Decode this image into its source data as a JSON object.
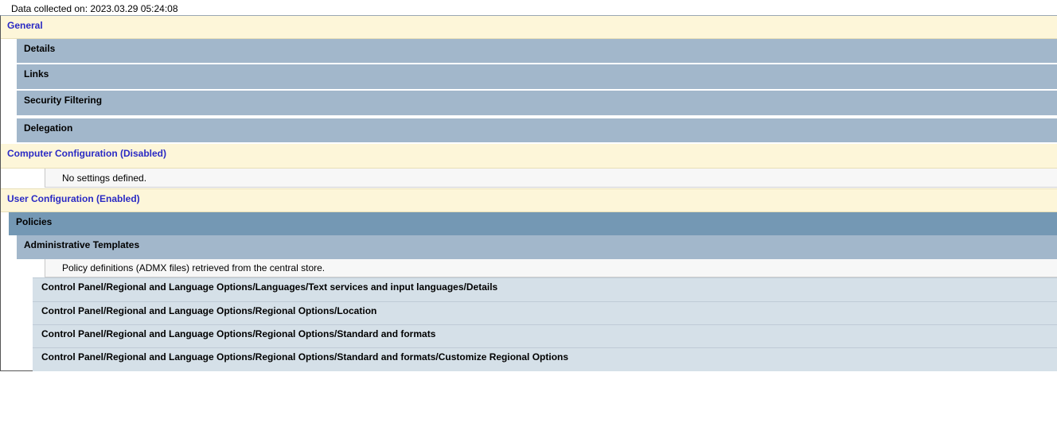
{
  "report": {
    "collected": "Data collected on: 2023.03.29 05:24:08",
    "general": {
      "title": "General",
      "details": "Details",
      "links": "Links",
      "security_filtering": "Security Filtering",
      "delegation": "Delegation"
    },
    "computer_configuration": {
      "title": "Computer Configuration (Disabled)",
      "note": "No settings defined."
    },
    "user_configuration": {
      "title": "User Configuration (Enabled)",
      "policies": "Policies",
      "administrative_templates": "Administrative Templates",
      "admx_note": "Policy definitions (ADMX files) retrieved from the central store.",
      "paths": [
        "Control Panel/Regional and Language Options/Languages/Text services and input languages/Details",
        "Control Panel/Regional and Language Options/Regional Options/Location",
        "Control Panel/Regional and Language Options/Regional Options/Standard and formats",
        "Control Panel/Regional and Language Options/Regional Options/Standard and formats/Customize Regional Options"
      ]
    }
  },
  "colors": {
    "section_background": "#fdf6d9",
    "section_text": "#2a2ac4",
    "category_background": "#a2b7cb",
    "policies_background": "#7498b4",
    "path_background": "#d5e0e8"
  }
}
